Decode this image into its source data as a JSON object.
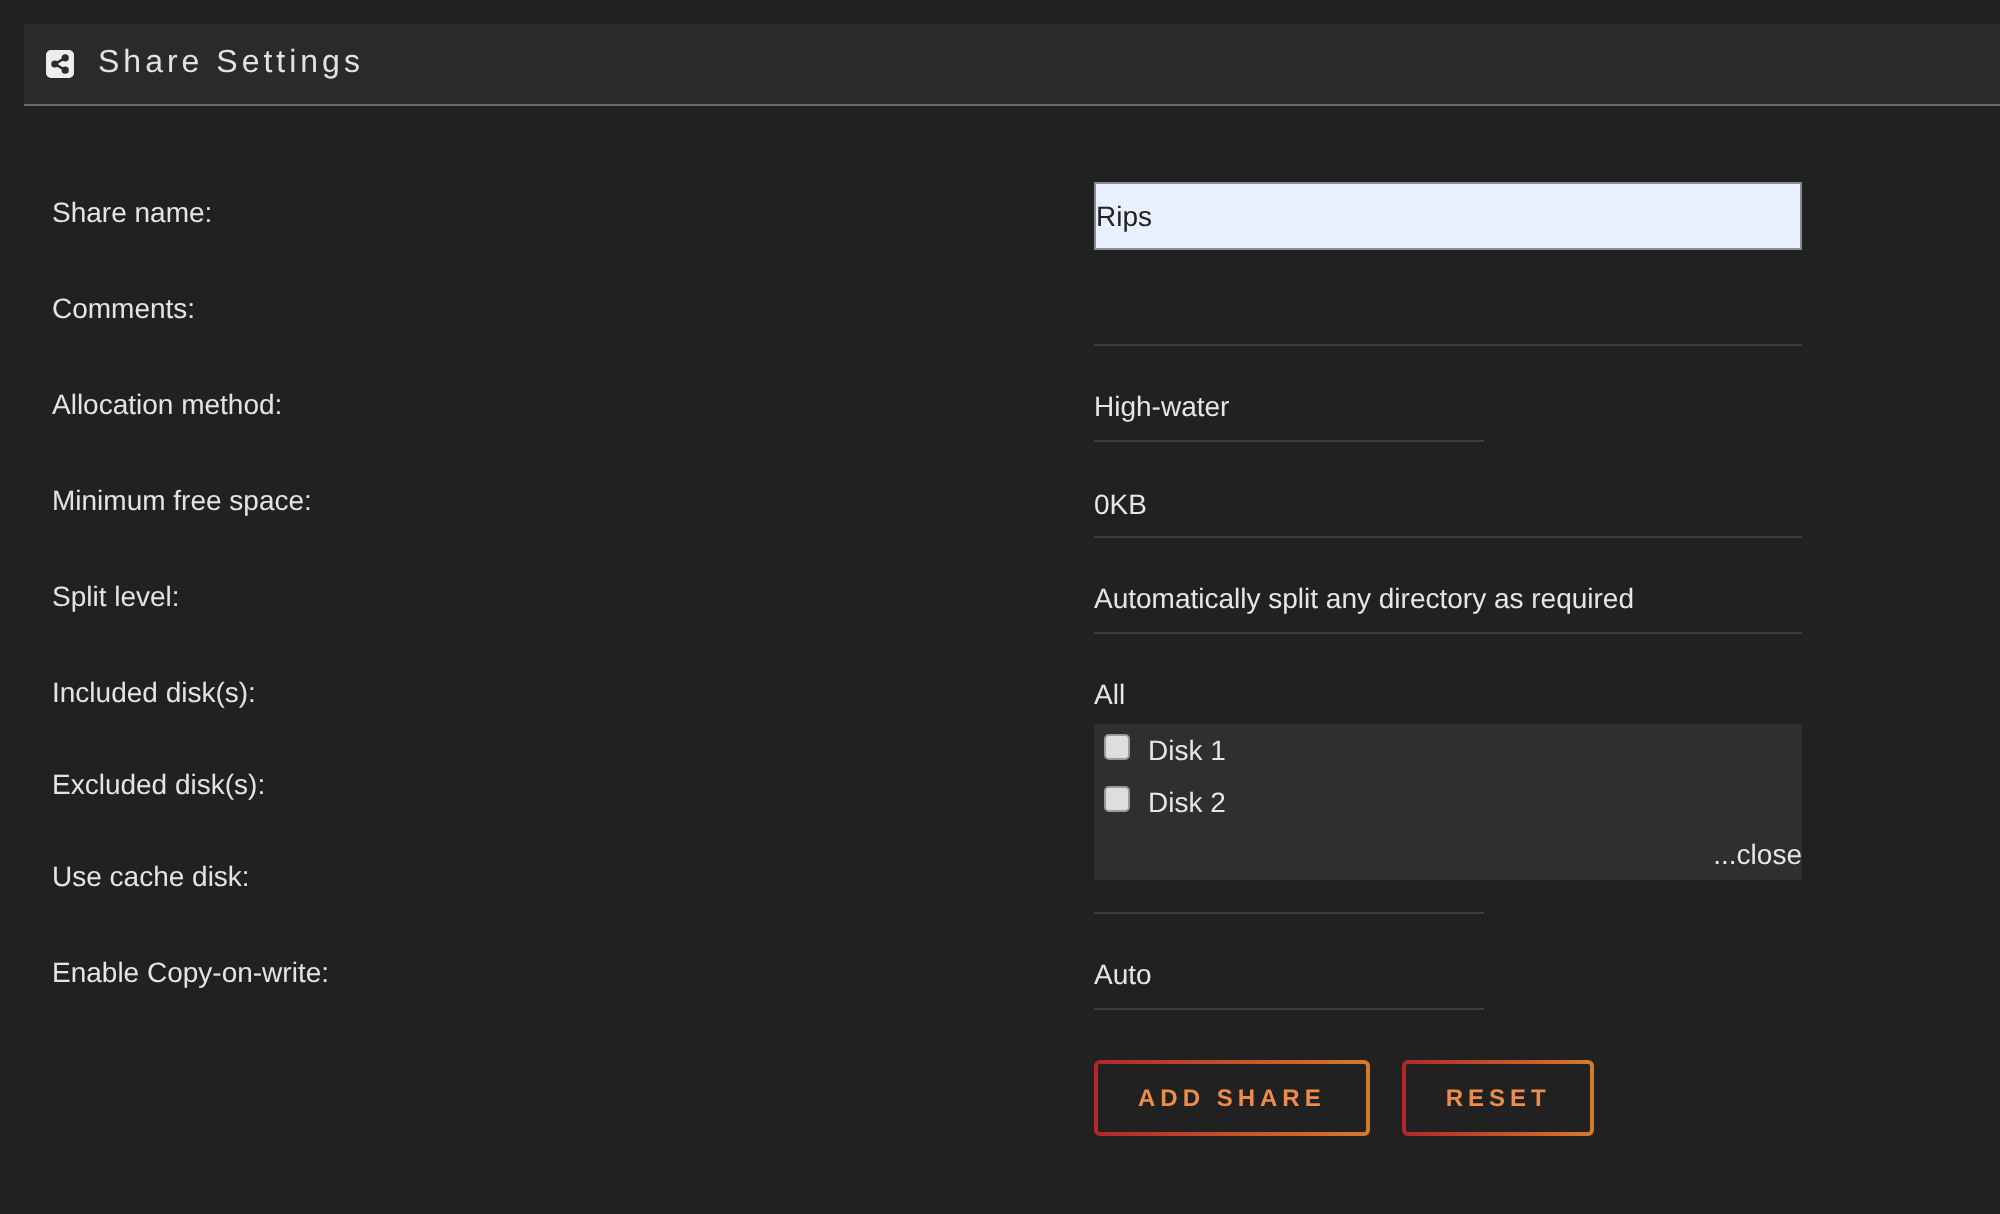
{
  "panel": {
    "title": "Share Settings"
  },
  "fields": [
    {
      "label": "Share name:",
      "kind": "text",
      "value": "Rips",
      "highlighted": true
    },
    {
      "label": "Comments:",
      "kind": "text",
      "highlighted": false
    },
    {
      "label": "Allocation method:",
      "kind": "select",
      "value": "High-water"
    },
    {
      "label": "Minimum free space:",
      "kind": "text",
      "value": "0KB",
      "highlighted": false
    },
    {
      "label": "Split level:",
      "kind": "longselect",
      "value": "Automatically split any directory as required"
    },
    {
      "label": "Included disk(s):",
      "kind": "longselect",
      "value": "All",
      "expanded": true,
      "options": [
        {
          "label": "Disk 1",
          "checked": false
        },
        {
          "label": "Disk 2",
          "checked": false
        }
      ],
      "close_link": "...close"
    },
    {
      "label": "Excluded disk(s):"
    },
    {
      "label": "Use cache disk:",
      "kind": "select"
    },
    {
      "label": "Enable Copy-on-write:",
      "kind": "select",
      "value": "Auto"
    }
  ],
  "buttons": [
    "ADD SHARE",
    "RESET"
  ]
}
